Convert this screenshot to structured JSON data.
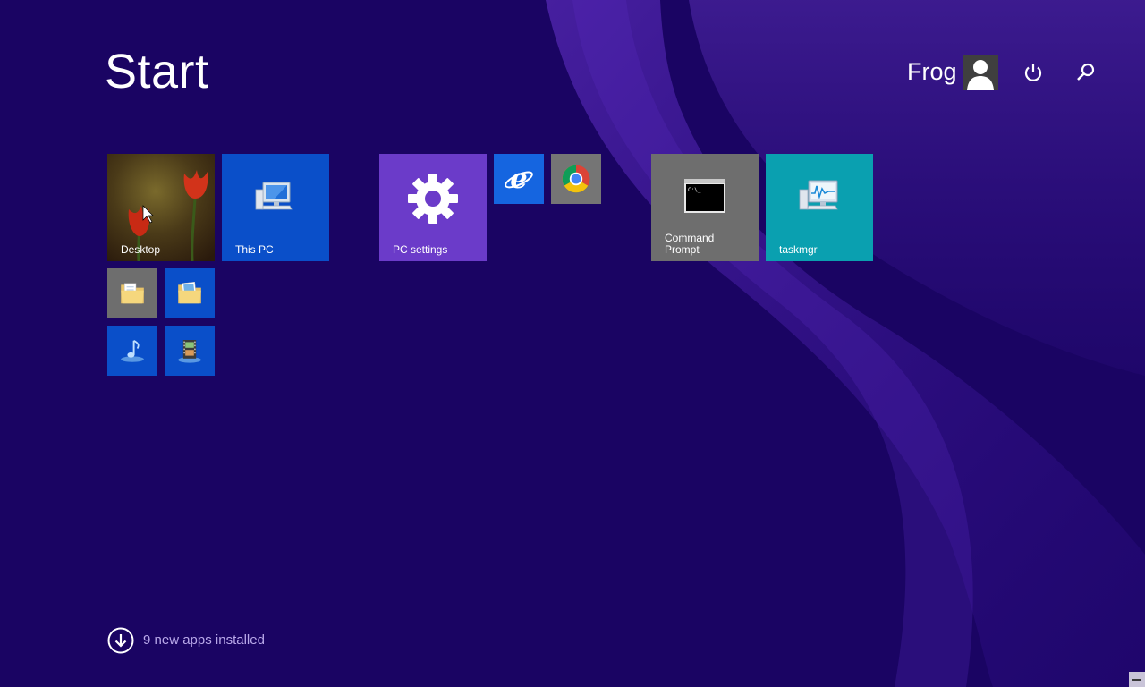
{
  "header": {
    "title": "Start",
    "user_name": "Frog",
    "avatar_icon": "user-silhouette-icon",
    "power_icon": "power-icon",
    "search_icon": "search-icon"
  },
  "tiles": {
    "desktop": {
      "label": "Desktop",
      "icon": "tulip-wallpaper",
      "color": "#5b3a1c"
    },
    "this_pc": {
      "label": "This PC",
      "icon": "computer-icon",
      "color": "#0a4fc9"
    },
    "pc_settings": {
      "label": "PC settings",
      "icon": "gear-icon",
      "color": "#6b3bc9"
    },
    "internet_explorer": {
      "icon": "internet-explorer-icon",
      "color": "#1565e0"
    },
    "chrome": {
      "icon": "chrome-icon",
      "color": "#757575"
    },
    "command_prompt": {
      "label": "Command\nPrompt",
      "icon": "console-icon",
      "color": "#6e6e6e"
    },
    "taskmgr": {
      "label": "taskmgr",
      "icon": "task-manager-icon",
      "color": "#0aa0b0"
    },
    "documents": {
      "icon": "documents-folder-icon",
      "color": "#6e6e6e"
    },
    "pictures": {
      "icon": "pictures-folder-icon",
      "color": "#0a4fc9"
    },
    "music": {
      "icon": "music-note-icon",
      "color": "#0a4fc9"
    },
    "videos": {
      "icon": "video-film-icon",
      "color": "#0a4fc9"
    }
  },
  "footer": {
    "new_apps_text": "9 new apps installed",
    "arrow_icon": "arrow-down-circle-icon"
  },
  "colors": {
    "background": "#1a0463",
    "accent_swirl": "#5a2ec2",
    "footer_text": "#b9a9ea"
  }
}
